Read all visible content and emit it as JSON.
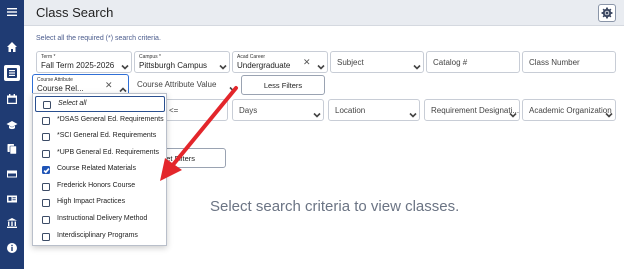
{
  "app": {
    "title": "Class Search"
  },
  "header": {
    "settings_icon": "gear-icon"
  },
  "subtitle": "Select all the required (*) search criteria.",
  "rail": {
    "items": [
      {
        "icon": "menu-icon"
      },
      {
        "icon": "home-icon"
      },
      {
        "icon": "grid-icon"
      },
      {
        "icon": "calendar-icon"
      },
      {
        "icon": "graduation-cap-icon"
      },
      {
        "icon": "documents-icon"
      },
      {
        "icon": "credit-card-icon"
      },
      {
        "icon": "id-card-icon"
      },
      {
        "icon": "bank-icon"
      },
      {
        "icon": "info-icon"
      }
    ]
  },
  "filters": {
    "term": {
      "label": "Term *",
      "value": "Fall Term 2025-2026"
    },
    "campus": {
      "label": "Campus *",
      "value": "Pittsburgh Campus"
    },
    "career": {
      "label": "Acad Career",
      "value": "Undergraduate"
    },
    "subject": {
      "placeholder": "Subject"
    },
    "catalog": {
      "placeholder": "Catalog #"
    },
    "class_number": {
      "placeholder": "Class Number"
    },
    "course_attribute": {
      "label": "Course Attribute",
      "value": "Course Rel..."
    },
    "course_attribute_value": {
      "placeholder": "Course Attribute Value"
    },
    "less_filters": "Less Filters",
    "start_time_fragment": "<=",
    "days": {
      "placeholder": "Days"
    },
    "location": {
      "placeholder": "Location"
    },
    "requirement": {
      "placeholder": "Requirement Designati..."
    },
    "academic_org": {
      "placeholder": "Academic Organization"
    },
    "reset_fragment": "et Filters"
  },
  "dropdown": {
    "items": [
      {
        "label": "Select all",
        "checked": false
      },
      {
        "label": "*DSAS General Ed. Requirements",
        "checked": false
      },
      {
        "label": "*SCI General Ed. Requirements",
        "checked": false
      },
      {
        "label": "*UPB General Ed. Requirements",
        "checked": false
      },
      {
        "label": "Course Related Materials",
        "checked": true
      },
      {
        "label": "Frederick Honors Course",
        "checked": false
      },
      {
        "label": "High Impact Practices",
        "checked": false
      },
      {
        "label": "Instructional Delivery Method",
        "checked": false
      },
      {
        "label": "Interdisciplinary Programs",
        "checked": false
      }
    ]
  },
  "empty_state": "Select search criteria to view classes.",
  "colors": {
    "rail": "#1f3b73",
    "accent": "#2f6fd6",
    "arrow": "#e3262b",
    "check": "#1f54b6"
  }
}
